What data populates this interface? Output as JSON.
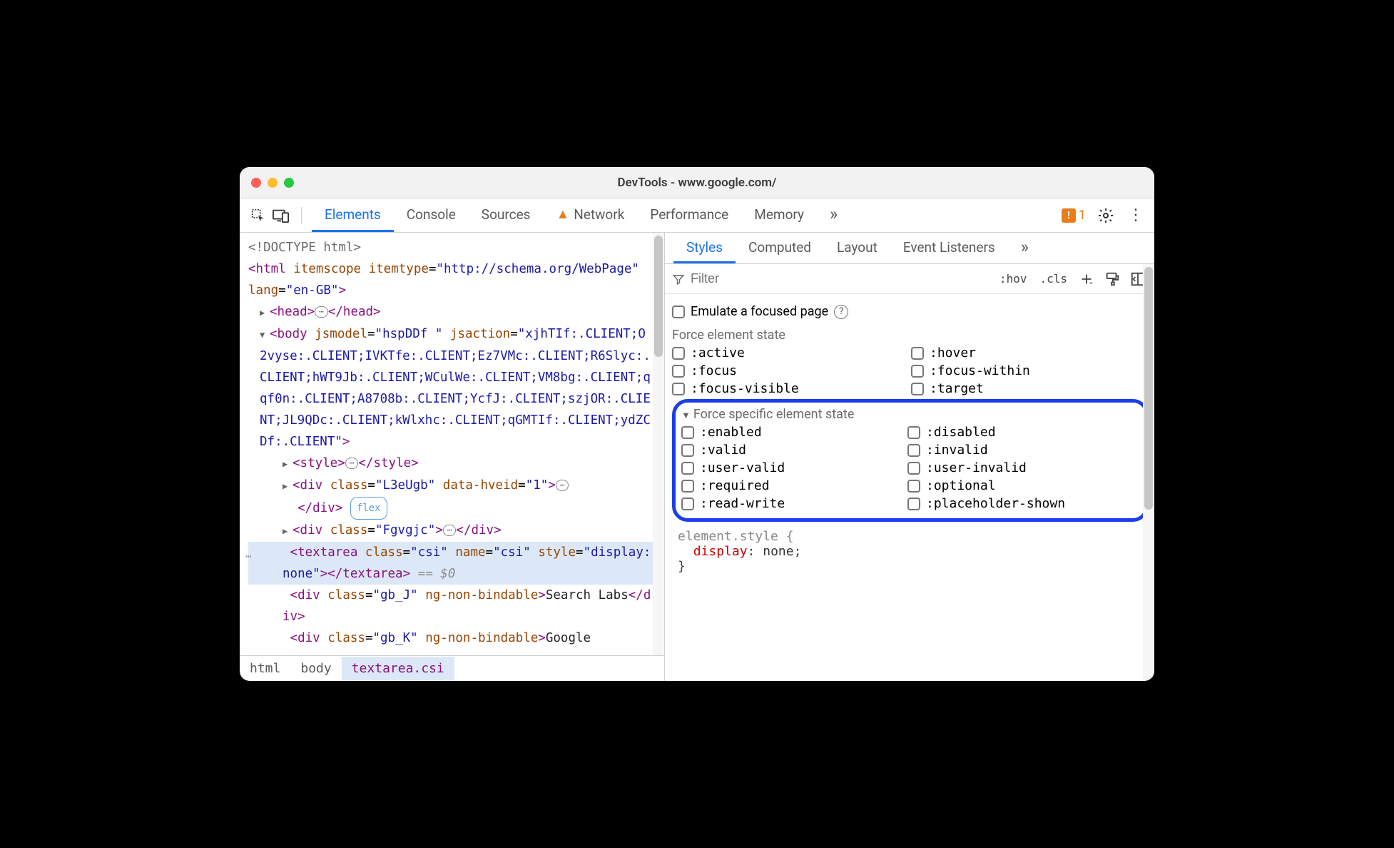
{
  "window_title": "DevTools - www.google.com/",
  "main_tabs": {
    "elements": "Elements",
    "console": "Console",
    "sources": "Sources",
    "network": "Network",
    "performance": "Performance",
    "memory": "Memory"
  },
  "warn_count": "1",
  "dom": {
    "doctype": "<!DOCTYPE html>",
    "html_open": "<html itemscope itemtype=\"http://schema.org/WebPage\" lang=\"en-GB\">",
    "head": {
      "open": "<head>",
      "close": "</head>"
    },
    "body_open": "<body jsmodel=\"hspDDf \" jsaction=\"xjhTIf:.CLIENT;O2vyse:.CLIENT;IVKTfe:.CLIENT;Ez7VMc:.CLIENT;R6Slyc:.CLIENT;hWT9Jb:.CLIENT;WCulWe:.CLIENT;VM8bg:.CLIENT;qqf0n:.CLIENT;A8708b:.CLIENT;YcfJ:.CLIENT;szjOR:.CLIENT;JL9QDc:.CLIENT;kWlxhc:.CLIENT;qGMTIf:.CLIENT;ydZCDf:.CLIENT\">",
    "style": {
      "open": "<style>",
      "close": "</style>"
    },
    "div1": {
      "open": "<div class=\"L3eUgb\" data-hveid=\"1\">",
      "close": "</div>",
      "badge": "flex"
    },
    "div2": {
      "open": "<div class=\"Fgvgjc\">",
      "close": "</div>"
    },
    "textarea_line": "<textarea class=\"csi\" name=\"csi\" style=\"display:none\"></textarea> == $0",
    "div_gbj": "<div class=\"gb_J\" ng-non-bindable>Search Labs</div>",
    "div_gbk": "<div class=\"gb_K\" ng-non-bindable>Google"
  },
  "breadcrumb": [
    "html",
    "body",
    "textarea.csi"
  ],
  "right_tabs": {
    "styles": "Styles",
    "computed": "Computed",
    "layout": "Layout",
    "event_listeners": "Event Listeners"
  },
  "styles_toolbar": {
    "filter_placeholder": "Filter",
    "hov": ":hov",
    "cls": ".cls"
  },
  "emulate_label": "Emulate a focused page",
  "force_state_label": "Force element state",
  "force_states": {
    "active": ":active",
    "hover": ":hover",
    "focus": ":focus",
    "focus_within": ":focus-within",
    "focus_visible": ":focus-visible",
    "target": ":target"
  },
  "force_specific_label": "Force specific element state",
  "specific_states": {
    "enabled": ":enabled",
    "disabled": ":disabled",
    "valid": ":valid",
    "invalid": ":invalid",
    "user_valid": ":user-valid",
    "user_invalid": ":user-invalid",
    "required": ":required",
    "optional": ":optional",
    "read_write": ":read-write",
    "placeholder_shown": ":placeholder-shown"
  },
  "element_style": {
    "selector": "element.style {",
    "prop": "display",
    "value": "none",
    "close": "}"
  }
}
